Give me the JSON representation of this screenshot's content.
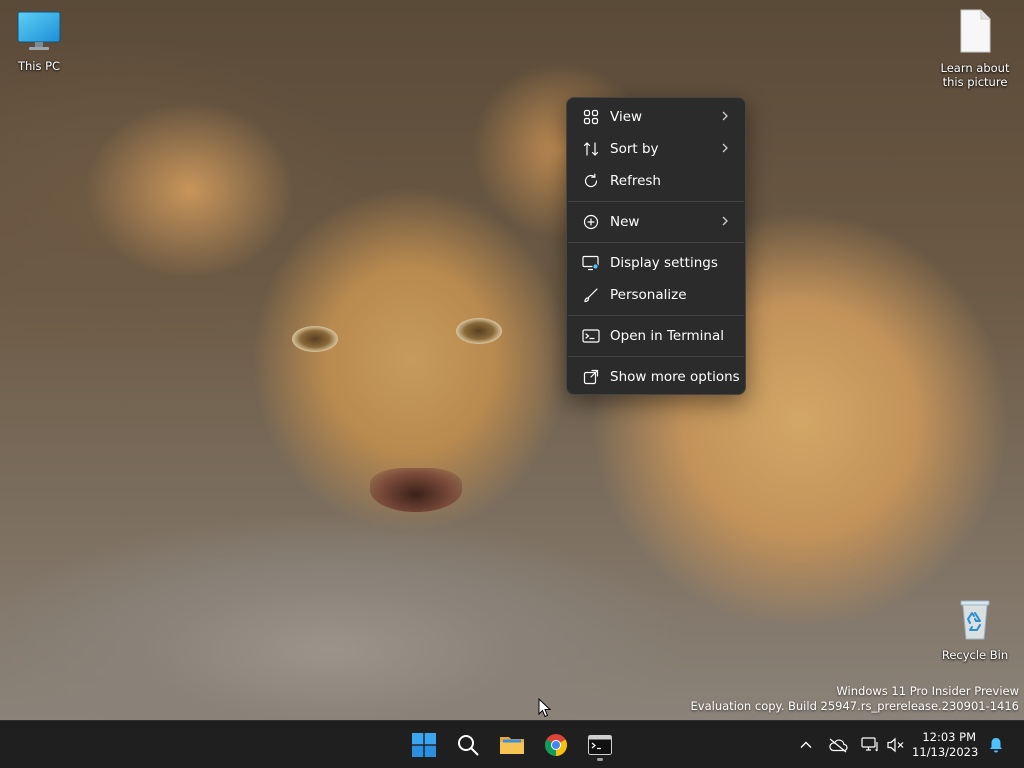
{
  "desktop": {
    "icons": [
      {
        "label": "This PC",
        "icon": "monitor-icon"
      },
      {
        "label": "Learn about this picture",
        "icon": "document-icon"
      },
      {
        "label": "Recycle Bin",
        "icon": "recycle-bin-icon"
      }
    ]
  },
  "context_menu": {
    "items": [
      {
        "label": "View",
        "icon": "grid-icon",
        "submenu": true
      },
      {
        "label": "Sort by",
        "icon": "sort-icon",
        "submenu": true
      },
      {
        "label": "Refresh",
        "icon": "refresh-icon",
        "submenu": false
      },
      {
        "label": "New",
        "icon": "plus-circle-icon",
        "submenu": true
      },
      {
        "label": "Display settings",
        "icon": "display-settings-icon",
        "submenu": false
      },
      {
        "label": "Personalize",
        "icon": "brush-icon",
        "submenu": false
      },
      {
        "label": "Open in Terminal",
        "icon": "terminal-icon",
        "submenu": false
      },
      {
        "label": "Show more options",
        "icon": "share-icon",
        "submenu": false
      }
    ]
  },
  "watermark": {
    "line1": "Windows 11 Pro Insider Preview",
    "line2": "Evaluation copy. Build 25947.rs_prerelease.230901-1416"
  },
  "taskbar": {
    "apps": [
      {
        "name": "start",
        "icon": "windows-logo-icon"
      },
      {
        "name": "search",
        "icon": "search-icon"
      },
      {
        "name": "file-explorer",
        "icon": "folder-icon"
      },
      {
        "name": "chrome",
        "icon": "chrome-icon"
      },
      {
        "name": "terminal",
        "icon": "terminal-icon",
        "active": true
      }
    ],
    "tray": {
      "time": "12:03 PM",
      "date": "11/13/2023"
    }
  },
  "colors": {
    "menu_bg": "#2b2b2b",
    "taskbar_bg": "#1f1f1f",
    "accent": "#4cc2ff"
  }
}
